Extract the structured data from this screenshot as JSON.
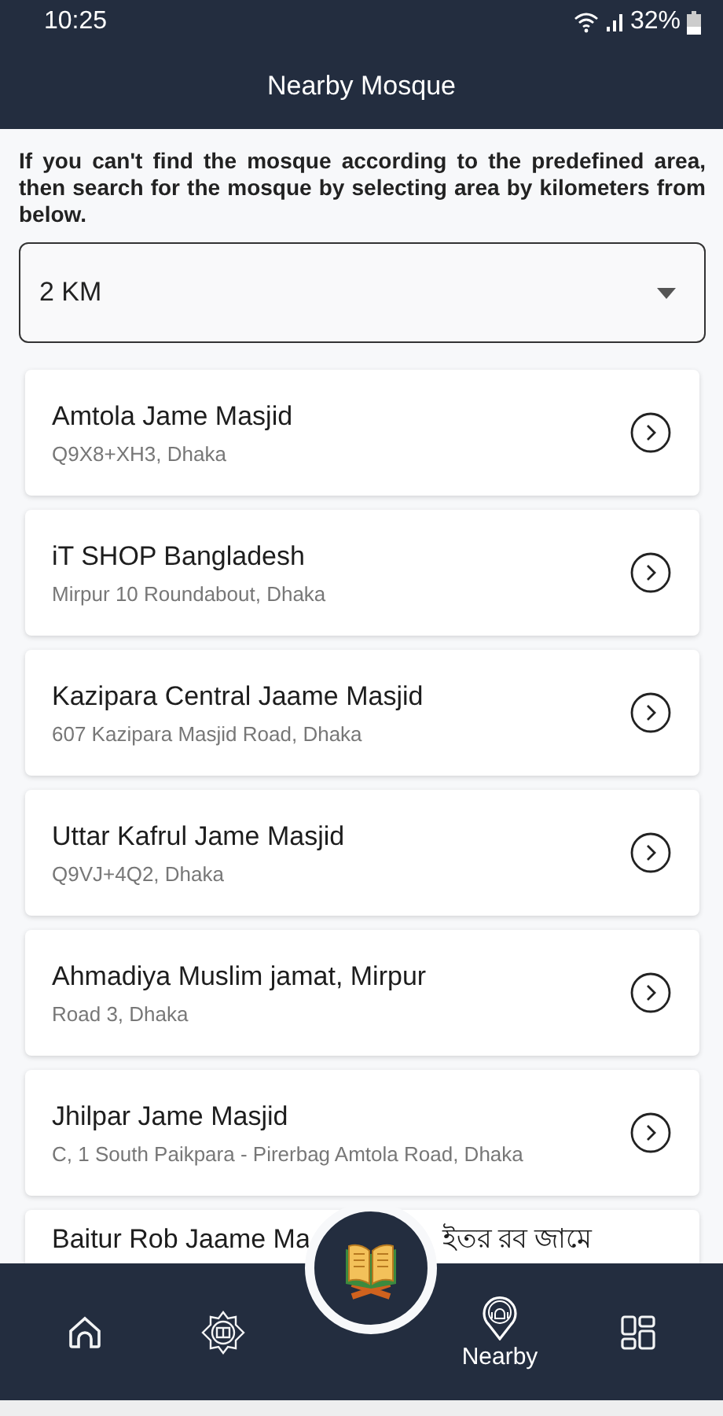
{
  "status_bar": {
    "time": "10:25",
    "battery": "32%"
  },
  "header": {
    "title": "Nearby Mosque"
  },
  "intro": "If you can't find the mosque according to the predefined area, then search for the mosque by selecting area by kilometers from below.",
  "distance_select": {
    "value": "2 KM"
  },
  "mosques": [
    {
      "name": "Amtola Jame Masjid",
      "address": "Q9X8+XH3, Dhaka"
    },
    {
      "name": "iT SHOP Bangladesh",
      "address": "Mirpur 10 Roundabout, Dhaka"
    },
    {
      "name": "Kazipara Central Jaame Masjid",
      "address": "607 Kazipara Masjid Road, Dhaka"
    },
    {
      "name": "Uttar Kafrul Jame Masjid",
      "address": "Q9VJ+4Q2, Dhaka"
    },
    {
      "name": "Ahmadiya Muslim jamat, Mirpur",
      "address": "Road 3, Dhaka"
    },
    {
      "name": "Jhilpar Jame Masjid",
      "address": "C, 1 South Paikpara - Pirerbag Amtola Road, Dhaka"
    },
    {
      "name": "Baitur Rob Jaame Ma",
      "name_continued": "ইতর রব জামে"
    }
  ],
  "bottom_nav": [
    {
      "kind": "home",
      "selected": false
    },
    {
      "kind": "emblem",
      "selected": false
    },
    {
      "kind": "quran",
      "selected": false
    },
    {
      "kind": "nearby",
      "label": "Nearby",
      "selected": true
    },
    {
      "kind": "dashboard",
      "selected": false
    }
  ]
}
